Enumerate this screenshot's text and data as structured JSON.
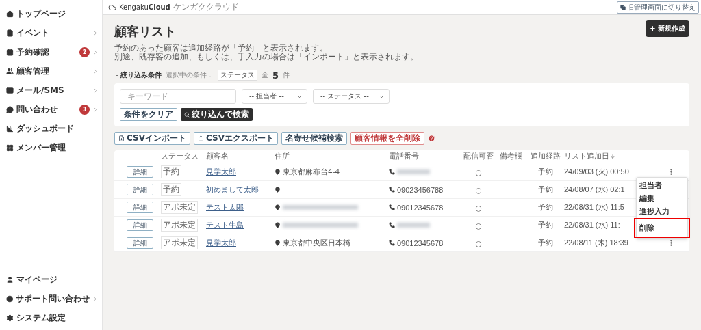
{
  "sidebar": {
    "items": [
      {
        "label": "トップページ",
        "submenu": false
      },
      {
        "label": "イベント",
        "submenu": true
      },
      {
        "label": "予約確認",
        "badge": "2",
        "submenu": true
      },
      {
        "label": "顧客管理",
        "submenu": true
      },
      {
        "label": "メール/SMS",
        "submenu": true
      },
      {
        "label": "問い合わせ",
        "badge": "3",
        "submenu": true
      },
      {
        "label": "ダッシュボード",
        "submenu": false
      },
      {
        "label": "メンバー管理",
        "submenu": false
      }
    ],
    "bottom_items": [
      {
        "label": "マイページ",
        "submenu": false
      },
      {
        "label": "サポート問い合わせ",
        "submenu": true
      },
      {
        "label": "システム設定",
        "submenu": false
      }
    ]
  },
  "header": {
    "logo": "Kengaku**Cloud**",
    "logo_sub": "ケンガククラウド",
    "switch_button": "旧管理画面に切り替え"
  },
  "page": {
    "title": "顧客リスト",
    "new_button": "+ 新規作成",
    "description": [
      "予約のあった顧客は追加経路が「予約」と表示されます。",
      "別途、既存客の追加、もしくは、手入力の場合は「インポート」と表示されます。"
    ]
  },
  "filter": {
    "toggle": "絞り込み条件",
    "expanded": true,
    "selected_label": "選択中の条件：",
    "selected_tag": "ステータス",
    "total_prefix": "全",
    "total": "5",
    "total_suffix": "件",
    "keyword_placeholder": "キーワード",
    "staff_select": "-- 担当者 --",
    "status_select": "-- ステータス --",
    "clear_button": "条件をクリア",
    "search_button": "絞り込んで検索"
  },
  "actions": [
    {
      "label": "CSVインポート",
      "kind": "import"
    },
    {
      "label": "CSVエクスポート",
      "kind": "export"
    },
    {
      "label": "名寄せ候補検索",
      "kind": "plain"
    },
    {
      "label": "顧客情報を全削除",
      "kind": "danger"
    }
  ],
  "table": {
    "columns": [
      {
        "label": "ステータス",
        "sorted": false
      },
      {
        "label": "顧客名",
        "sorted": false
      },
      {
        "label": "住所",
        "sorted": false
      },
      {
        "label": "電話番号",
        "sorted": false
      },
      {
        "label": "配信可否",
        "sorted": false
      },
      {
        "label": "備考欄",
        "sorted": false
      },
      {
        "label": "追加経路",
        "sorted": false
      },
      {
        "label": "リスト追加日",
        "sorted": true
      }
    ],
    "rows": [
      {
        "detail": "詳細",
        "status": "予約",
        "name": "見学太郎",
        "address": "東京都麻布台4-4",
        "address_blurred": false,
        "phone_blurred": true,
        "delivery": "○",
        "route": "予約",
        "date": "24/09/03 (火) 00:50",
        "more_menu": true
      },
      {
        "detail": "詳細",
        "status": "予約",
        "name": "初めまして太郎",
        "address_blurred": false,
        "phone": "09023456788",
        "phone_blurred": false,
        "delivery": "○",
        "route": "予約",
        "date": "24/08/07 (水) 02:1"
      },
      {
        "detail": "詳細",
        "status": "アポ未定",
        "name": "テスト太郎",
        "address_blurred": true,
        "phone": "09012345678",
        "phone_blurred": false,
        "delivery": "○",
        "route": "予約",
        "date": "22/08/31 (水) 11:5"
      },
      {
        "detail": "詳細",
        "status": "アポ未定",
        "name": "テスト牛島",
        "address_blurred": true,
        "phone_blurred": true,
        "delivery": "○",
        "route": "予約",
        "date": "22/08/31 (水) 11:"
      },
      {
        "detail": "詳細",
        "status": "アポ未定",
        "name": "見学太郎",
        "address": "東京都中央区日本橋",
        "address_blurred": false,
        "phone": "09012345678",
        "phone_blurred": false,
        "delivery": "○",
        "route": "予約",
        "date": "22/08/11 (木) 18:39",
        "more_menu": true
      }
    ]
  },
  "row_menu": {
    "items": [
      {
        "label": "担当者",
        "highlighted": false
      },
      {
        "label": "編集",
        "highlighted": false
      },
      {
        "label": "進捗入力",
        "highlighted": false
      },
      {
        "label": "削除",
        "highlighted": true
      }
    ]
  }
}
